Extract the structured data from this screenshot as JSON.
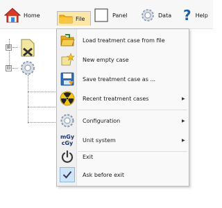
{
  "toolbar": {
    "home_label": "Home",
    "file_label": "File",
    "panel_label": "Panel",
    "data_label": "Data",
    "help_label": "Help",
    "help_glyph": "?"
  },
  "file_menu": {
    "items": [
      {
        "label": "Load treatment case from file",
        "icon": "folder-open-icon"
      },
      {
        "label": "New empty case",
        "icon": "new-case-icon"
      },
      {
        "label": "Save treatment case as ...",
        "icon": "save-icon"
      },
      {
        "label": "Recent treatment cases",
        "icon": "radiation-icon",
        "submenu": true
      },
      {
        "label": "Configuration",
        "icon": "gear-icon",
        "submenu": true
      },
      {
        "label": "Unit system",
        "icon": "mgy-cgy-icon",
        "submenu": true
      },
      {
        "label": "Exit",
        "icon": "power-icon"
      },
      {
        "label": "Ask before exit",
        "icon": "check-icon",
        "checked": true
      }
    ],
    "submenu_arrow": "▶",
    "unit_icon_top": "mGy",
    "unit_icon_bottom": "cGy"
  },
  "tree": {
    "expand_glyph": "⊞",
    "collapse_glyph": "⊟"
  },
  "colors": {
    "file_highlight": "#fde7a8",
    "menu_background": "#f9f9f9",
    "checked_background": "#cfe4f7"
  }
}
